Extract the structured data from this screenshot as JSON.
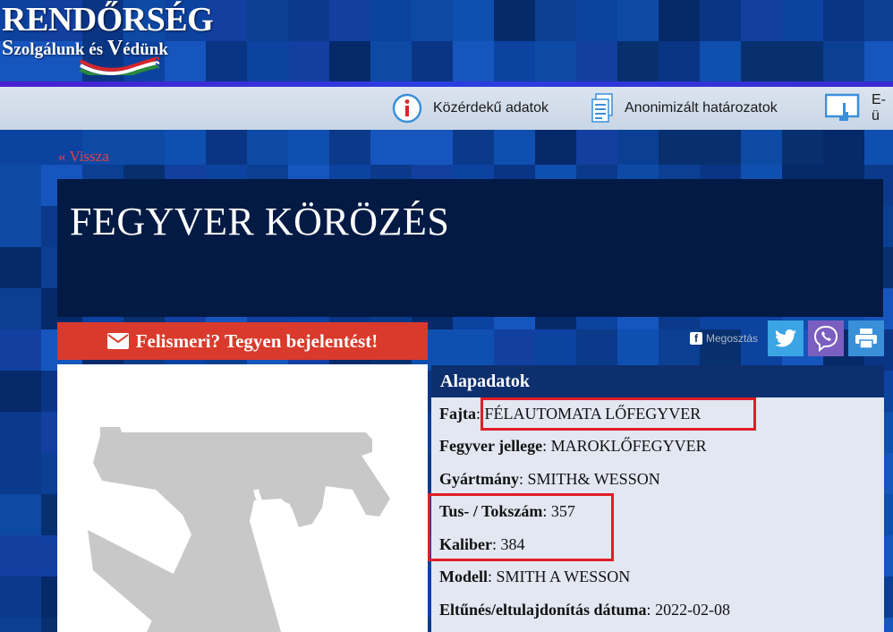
{
  "header": {
    "logo_title": "RENDŐRSÉG",
    "logo_subtitle_s": "S",
    "logo_subtitle_1": "zolgálunk és ",
    "logo_subtitle_v": "V",
    "logo_subtitle_2": "édünk"
  },
  "nav": {
    "items": [
      {
        "label": "Közérdekű adatok",
        "icon": "info-icon"
      },
      {
        "label": "Anonimizált határozatok",
        "icon": "document-icon"
      },
      {
        "label": "E-ü",
        "icon": "touch-screen-icon"
      }
    ]
  },
  "back_link": "« Vissza",
  "page_title": "FEGYVER KÖRÖZÉS",
  "report_button": "Felismeri? Tegyen bejelentést!",
  "share": {
    "facebook_label": "Megosztás",
    "buttons": [
      "twitter-icon",
      "viber-icon",
      "print-icon"
    ]
  },
  "details": {
    "heading": "Alapadatok",
    "rows": [
      {
        "label": "Fajta",
        "value": "FÉLAUTOMATA LŐFEGYVER"
      },
      {
        "label": "Fegyver jellege",
        "value": "MAROKLŐFEGYVER"
      },
      {
        "label": "Gyártmány",
        "value": "SMITH& WESSON"
      },
      {
        "label": "Tus- / Tokszám",
        "value": "357"
      },
      {
        "label": "Kaliber",
        "value": "384"
      },
      {
        "label": "Modell",
        "value": "SMITH A WESSON"
      },
      {
        "label": "Eltűnés/eltulajdonítás dátuma",
        "value": "2022-02-08"
      }
    ]
  },
  "colors": {
    "background": "#0a3a8c",
    "title_box": "#031a44",
    "report_button": "#d93a2b",
    "highlight": "#e11d25",
    "details_header": "#0e2f6e",
    "details_body": "#e2e7f2"
  }
}
